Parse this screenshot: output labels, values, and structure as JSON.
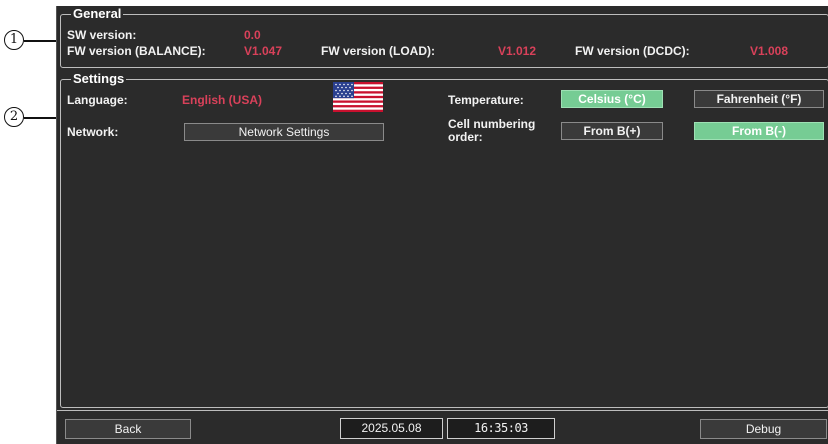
{
  "callouts": {
    "general": "1",
    "settings": "2"
  },
  "general": {
    "title": "General",
    "sw_version_label": "SW version:",
    "sw_version_value": "0.0",
    "fw_balance_label": "FW version (BALANCE):",
    "fw_balance_value": "V1.047",
    "fw_load_label": "FW version (LOAD):",
    "fw_load_value": "V1.012",
    "fw_dcdc_label": "FW version (DCDC):",
    "fw_dcdc_value": "V1.008"
  },
  "settings": {
    "title": "Settings",
    "language_label": "Language:",
    "language_value": "English (USA)",
    "language_flag_icon": "us-flag-icon",
    "temperature_label": "Temperature:",
    "temperature_options": [
      "Celsius (°C)",
      "Fahrenheit (°F)"
    ],
    "temperature_selected": "Celsius (°C)",
    "network_label": "Network:",
    "network_button": "Network Settings",
    "cell_order_label_line1": "Cell numbering",
    "cell_order_label_line2": "order:",
    "cell_order_options": [
      "From B(+)",
      "From B(-)"
    ],
    "cell_order_selected": "From B(-)"
  },
  "bottom": {
    "back_label": "Back",
    "date": "2025.05.08",
    "time": "16:35:03",
    "debug_label": "Debug"
  },
  "colors": {
    "background": "#2b2b2b",
    "value_text": "#d9415a",
    "active_button": "#76cc94"
  }
}
